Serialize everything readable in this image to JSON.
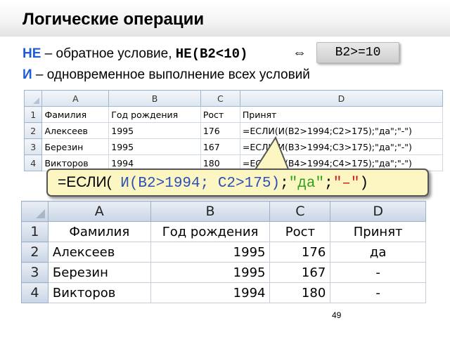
{
  "title": "Логические операции",
  "line1": {
    "keyword": "НЕ",
    "text": " – обратное условие, ",
    "code": "НЕ(B2<10)",
    "equiv": "⇔",
    "badge": "B2>=10"
  },
  "line2": {
    "keyword": "И",
    "text": " – одновременное выполнение всех условий"
  },
  "sheet_top": {
    "columns": [
      "A",
      "B",
      "C",
      "D"
    ],
    "rows": [
      {
        "n": "1",
        "cells": [
          "Фамилия",
          "Год рождения",
          "Рост",
          "Принят"
        ]
      },
      {
        "n": "2",
        "cells": [
          "Алексеев",
          "1995",
          "176",
          "=ЕСЛИ(И(B2>1994;C2>175);\"да\";\"-\")"
        ]
      },
      {
        "n": "3",
        "cells": [
          "Березин",
          "1995",
          "167",
          "=ЕСЛИ(И(B3>1994;C3>175);\"да\";\"-\")"
        ]
      },
      {
        "n": "4",
        "cells": [
          "Викторов",
          "1994",
          "180",
          "=ЕСЛИ(И(B4>1994;C4>175);\"да\";\"-\")"
        ]
      }
    ]
  },
  "callout": {
    "prefix": "=ЕСЛИ(",
    "condition": " И(B2>1994; C2>175)",
    "sep1": ";",
    "yes": "\"да\"",
    "sep2": ";",
    "no": "\"–\"",
    "close": ")"
  },
  "sheet_bottom": {
    "columns": [
      "A",
      "B",
      "C",
      "D"
    ],
    "rows": [
      {
        "n": "1",
        "cells": [
          "Фамилия",
          "Год рождения",
          "Рост",
          "Принят"
        ]
      },
      {
        "n": "2",
        "cells": [
          "Алексеев",
          "1995",
          "176",
          "да"
        ]
      },
      {
        "n": "3",
        "cells": [
          "Березин",
          "1995",
          "167",
          "-"
        ]
      },
      {
        "n": "4",
        "cells": [
          "Викторов",
          "1994",
          "180",
          "-"
        ]
      }
    ]
  },
  "page_number": "49"
}
